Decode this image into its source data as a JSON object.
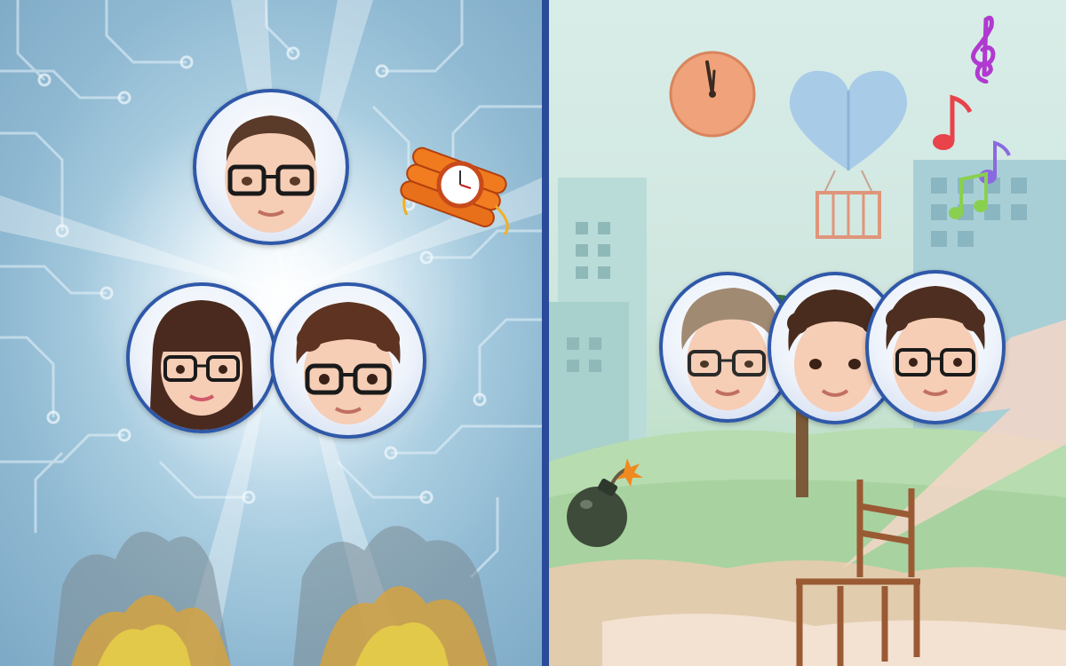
{
  "scenes": {
    "left": {
      "icons": [
        "circuit-board-background",
        "light-burst",
        "fire-smoke",
        "dynamite-clock-icon"
      ],
      "avatars": [
        {
          "id": "short-hair-glasses-boy",
          "hair": "#5a3a28"
        },
        {
          "id": "long-hair-glasses-girl",
          "hair": "#4a2a1e"
        },
        {
          "id": "curly-hair-glasses-boy",
          "hair": "#5e3322"
        }
      ]
    },
    "right": {
      "icons": [
        "wall-clock-icon",
        "heart-balloon-icon",
        "treble-clef-icon",
        "music-note-icon",
        "bomb-icon",
        "lightning-bolt",
        "wooden-chair",
        "palm-tree"
      ],
      "avatars": [
        {
          "id": "blond-swept-hair-glasses-boy",
          "hair": "#a08a72"
        },
        {
          "id": "curly-hair-boy",
          "hair": "#4a2c1e"
        },
        {
          "id": "curly-hair-glasses-boy-2",
          "hair": "#4e2e20"
        }
      ]
    }
  },
  "colors": {
    "frame": "#2a4a9a",
    "avatar_ring": "#2f58a8",
    "skin": "#f6cdb5",
    "clock_face": "#f0a27a"
  }
}
